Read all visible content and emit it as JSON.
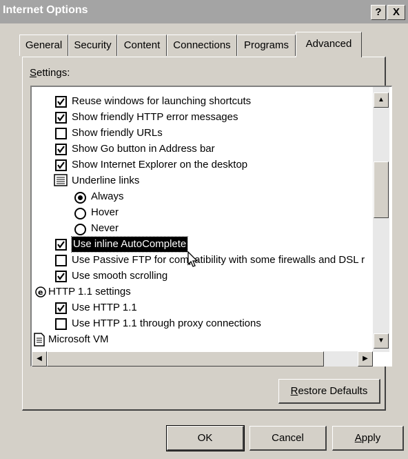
{
  "window": {
    "title": "Internet Options",
    "help_button": "?",
    "close_button": "X"
  },
  "tabs": [
    {
      "label": "General",
      "active": false
    },
    {
      "label": "Security",
      "active": false
    },
    {
      "label": "Content",
      "active": false
    },
    {
      "label": "Connections",
      "active": false
    },
    {
      "label": "Programs",
      "active": false
    },
    {
      "label": "Advanced",
      "active": true
    }
  ],
  "settings_label": {
    "mnemonic": "S",
    "rest": "ettings:"
  },
  "settings": [
    {
      "type": "checkbox",
      "checked": true,
      "label": "Reuse windows for launching shortcuts"
    },
    {
      "type": "checkbox",
      "checked": true,
      "label": "Show friendly HTTP error messages"
    },
    {
      "type": "checkbox",
      "checked": false,
      "label": "Show friendly URLs"
    },
    {
      "type": "checkbox",
      "checked": true,
      "label": "Show Go button in Address bar"
    },
    {
      "type": "checkbox",
      "checked": true,
      "label": "Show Internet Explorer on the desktop"
    },
    {
      "type": "group",
      "icon": "list-icon",
      "label": "Underline links"
    },
    {
      "type": "radio",
      "checked": true,
      "label": "Always"
    },
    {
      "type": "radio",
      "checked": false,
      "label": "Hover"
    },
    {
      "type": "radio",
      "checked": false,
      "label": "Never"
    },
    {
      "type": "checkbox",
      "checked": true,
      "label": "Use inline AutoComplete",
      "selected": true
    },
    {
      "type": "checkbox",
      "checked": false,
      "label": "Use Passive FTP for compatibility with some firewalls and DSL r"
    },
    {
      "type": "checkbox",
      "checked": true,
      "label": "Use smooth scrolling"
    },
    {
      "type": "group",
      "icon": "globe-icon",
      "label": "HTTP 1.1 settings"
    },
    {
      "type": "checkbox",
      "checked": true,
      "label": "Use HTTP 1.1"
    },
    {
      "type": "checkbox",
      "checked": false,
      "label": "Use HTTP 1.1 through proxy connections"
    },
    {
      "type": "group",
      "icon": "document-icon",
      "label": "Microsoft VM"
    }
  ],
  "buttons": {
    "restore_defaults": {
      "mnemonic": "R",
      "rest": "estore Defaults"
    },
    "ok": "OK",
    "cancel": "Cancel",
    "apply": {
      "mnemonic": "A",
      "rest": "pply"
    }
  }
}
